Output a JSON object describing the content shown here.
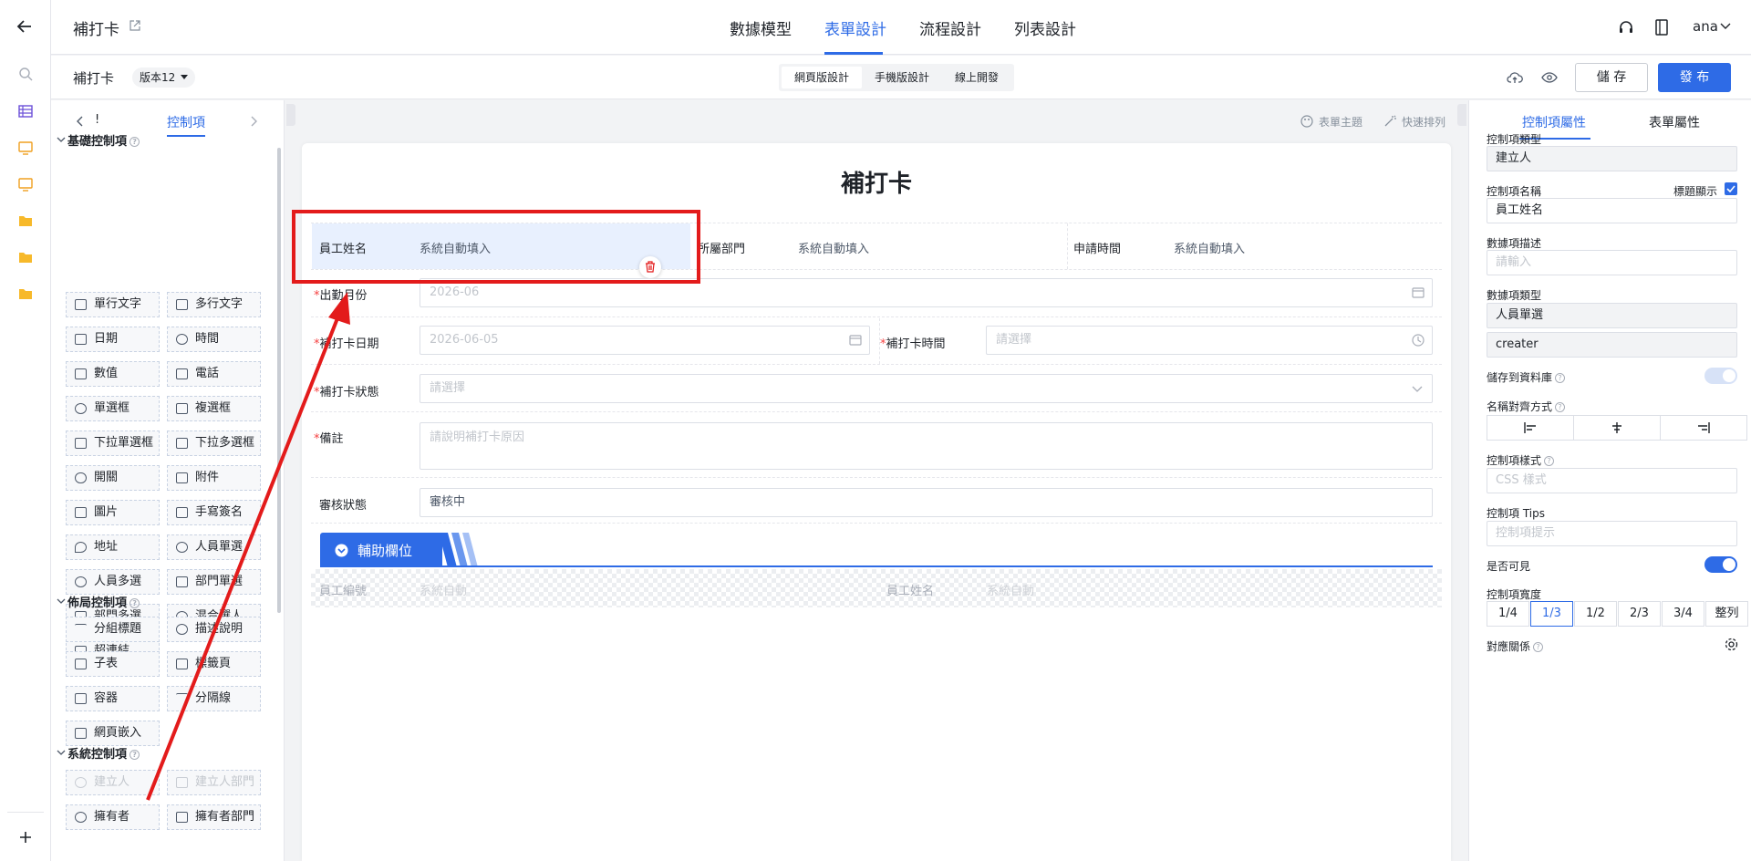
{
  "rail": {
    "icons": [
      "back-arrow-icon",
      "search-icon",
      "table-icon",
      "screen-icon",
      "screen-icon",
      "folder-icon",
      "folder-icon",
      "folder-icon",
      "plus-icon"
    ]
  },
  "topbar": {
    "app_title": "補打卡",
    "tabs": [
      "數據模型",
      "表單設計",
      "流程設計",
      "列表設計"
    ],
    "active_tab": "表單設計",
    "user": "ana"
  },
  "subbar": {
    "form_name": "補打卡",
    "version": "版本12",
    "segments": [
      "網頁版設計",
      "手機版設計",
      "線上開發"
    ],
    "save_label": "儲 存",
    "publish_label": "發 布"
  },
  "palette": {
    "tab_label": "控制項",
    "tab_left": "!",
    "sections": [
      {
        "title": "基礎控制項",
        "items": [
          "單行文字",
          "多行文字",
          "日期",
          "時間",
          "數值",
          "電話",
          "單選框",
          "複選框",
          "下拉單選框",
          "下拉多選框",
          "開關",
          "附件",
          "圖片",
          "手寫簽名",
          "地址",
          "人員單選",
          "人員多選",
          "部門單選",
          "部門多選",
          "混合選人",
          "超連結"
        ]
      },
      {
        "title": "佈局控制項",
        "items": [
          "分組標題",
          "描述說明",
          "子表",
          "標籤頁",
          "容器",
          "分隔線",
          "網頁嵌入"
        ]
      },
      {
        "title": "系統控制項",
        "items": [
          "建立人",
          "建立人部門",
          "擁有者",
          "擁有者部門"
        ]
      }
    ]
  },
  "canvas": {
    "toolbar_theme": "表單主題",
    "toolbar_arrange": "快速排列",
    "form_title": "補打卡",
    "fields": {
      "employee_name_label": "員工姓名",
      "employee_name_value": "系統自動填入",
      "department_label": "所屬部門",
      "department_value": "系統自動填入",
      "apply_time_label": "申請時間",
      "apply_time_value": "系統自動填入",
      "month_label": "出勤月份",
      "month_placeholder": "2026-06",
      "date_label": "補打卡日期",
      "date_placeholder": "2026-06-05",
      "time_label": "補打卡時間",
      "time_placeholder": "請選擇",
      "status_label": "補打卡狀態",
      "status_placeholder": "請選擇",
      "remark_label": "備註",
      "remark_placeholder": "請說明補打卡原因",
      "review_label": "審核狀態",
      "review_value": "審核中"
    },
    "aux_group_title": "輔助欄位",
    "aux_fields": {
      "emp_no_label": "員工編號",
      "emp_no_value": "系統自動",
      "emp_name_label": "員工姓名",
      "emp_name_value": "系統自動"
    }
  },
  "props": {
    "tabs": [
      "控制項屬性",
      "表單屬性"
    ],
    "control_type_label": "控制項類型",
    "control_type_value": "建立人",
    "control_name_label": "控制項名稱",
    "title_display_label": "標題顯示",
    "control_name_value": "員工姓名",
    "data_desc_label": "數據項描述",
    "data_desc_placeholder": "請輸入",
    "data_type_label": "數據項類型",
    "data_type_value": "人員單選",
    "data_key_value": "creater",
    "save_db_label": "儲存到資料庫",
    "align_label": "名稱對齊方式",
    "style_label": "控制項樣式",
    "style_placeholder": "CSS 樣式",
    "tips_label": "控制項 Tips",
    "tips_placeholder": "控制項提示",
    "visible_label": "是否可見",
    "width_label": "控制項寬度",
    "width_options": [
      "1/4",
      "1/3",
      "1/2",
      "2/3",
      "3/4",
      "整列"
    ],
    "width_selected": "1/3",
    "mapping_label": "對應關係"
  },
  "colors": {
    "accent": "#2e6be6",
    "annotation": "#e31b1b",
    "selected_bg": "#e8f0fe"
  }
}
